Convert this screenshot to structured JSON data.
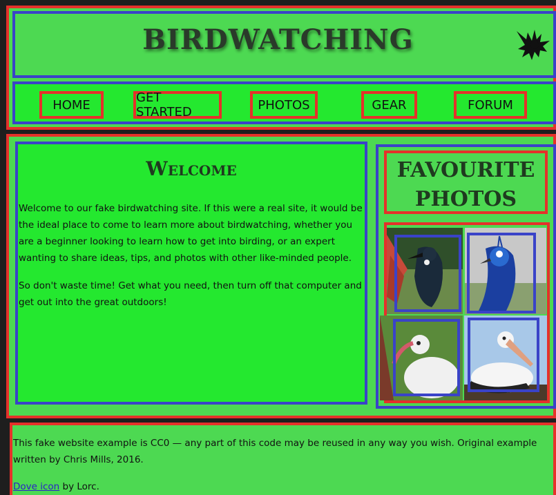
{
  "header": {
    "title": "BIRDWATCHING",
    "logo_icon": "bird-icon"
  },
  "nav": {
    "items": [
      {
        "label": "HOME"
      },
      {
        "label": "GET STARTED"
      },
      {
        "label": "PHOTOS"
      },
      {
        "label": "GEAR"
      },
      {
        "label": "FORUM"
      }
    ]
  },
  "welcome": {
    "heading": "Welcome",
    "paragraphs": [
      "Welcome to our fake birdwatching site. If this were a real site, it would be the ideal place to come to learn more about birdwatching, whether you are a beginner looking to learn how to get into birding, or an expert wanting to share ideas, tips, and photos with other like-minded people.",
      "So don't waste time! Get what you need, then turn off that computer and get out into the great outdoors!"
    ]
  },
  "favourites": {
    "heading_line1": "FAVOURITE",
    "heading_line2": "PHOTOS",
    "photos": [
      {
        "name": "tui-photo",
        "colors": [
          "#1a2a3a",
          "#c74a3a",
          "#6b8a4a"
        ]
      },
      {
        "name": "peacock-photo",
        "colors": [
          "#1b3fa0",
          "#2a6ad0",
          "#8aa070"
        ]
      },
      {
        "name": "ibis-photo",
        "colors": [
          "#f0f0f0",
          "#d25a6a",
          "#5a8a3a"
        ]
      },
      {
        "name": "pelican-photo",
        "colors": [
          "#f5f5f5",
          "#e0a080",
          "#a8c8e8"
        ]
      }
    ]
  },
  "footer": {
    "line1": "This fake website example is CC0 — any part of this code may be reused in any way you wish. Original example written by Chris Mills, 2016.",
    "link_text": "Dove icon",
    "line2_suffix": " by Lorc."
  }
}
